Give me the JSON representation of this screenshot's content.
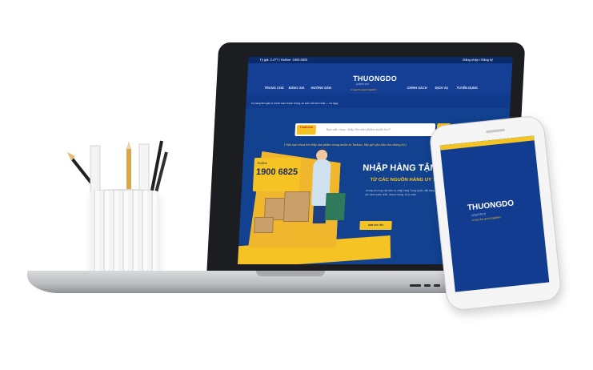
{
  "site": {
    "topbar": {
      "left_text": "Tỷ giá: 3.4?? | Hotline: 1900 6825",
      "right_text": "Đăng nhập / Đăng ký"
    },
    "nav_left": [
      "TRANG CHỦ",
      "BẢNG GIÁ",
      "HƯỚNG DẪN"
    ],
    "nav_right": [
      "CHÍNH SÁCH",
      "DỊCH VỤ",
      "TUYỂN DỤNG"
    ],
    "logo": {
      "name": "THUONGDO",
      "sub": "LOGISTICS",
      "tagline": "to say the good together"
    },
    "notice": "Tra hàng đơn giản & Thanh toán nhanh chóng, an toàn, tiết kiệm nhất — Tải ngay",
    "search": {
      "brand": "Tmall.com",
      "placeholder": "Bạn cần mua, nhập tên sản phẩm muốn tìm?"
    },
    "caption": "( Nếu bạn chưa tìm thấy sản phẩm mong muốn từ Taobao, hãy gửi yêu cầu cho chúng tôi )",
    "hotline": {
      "label": "Hotline",
      "number": "1900 6825"
    },
    "hero": {
      "title": "NHẬP HÀNG TẬN GỐC",
      "subtitle": "TỪ CÁC NGUỒN HÀNG UY TÍN",
      "description": "Chúng tôi cung cấp dịch vụ nhập hàng Trung Quốc, đặt hàng từ Taobao, 1688, Tmall với chi phí cạnh tranh nhất, nhanh chóng và an toàn.",
      "button": "XEM CHI TIẾT"
    }
  },
  "phone": {
    "logo": "THUONGDO",
    "sub": "LOGISTICS",
    "tagline": "to say the good together"
  },
  "colors": {
    "brand_blue": "#143f95",
    "accent_yellow": "#f6c324"
  }
}
